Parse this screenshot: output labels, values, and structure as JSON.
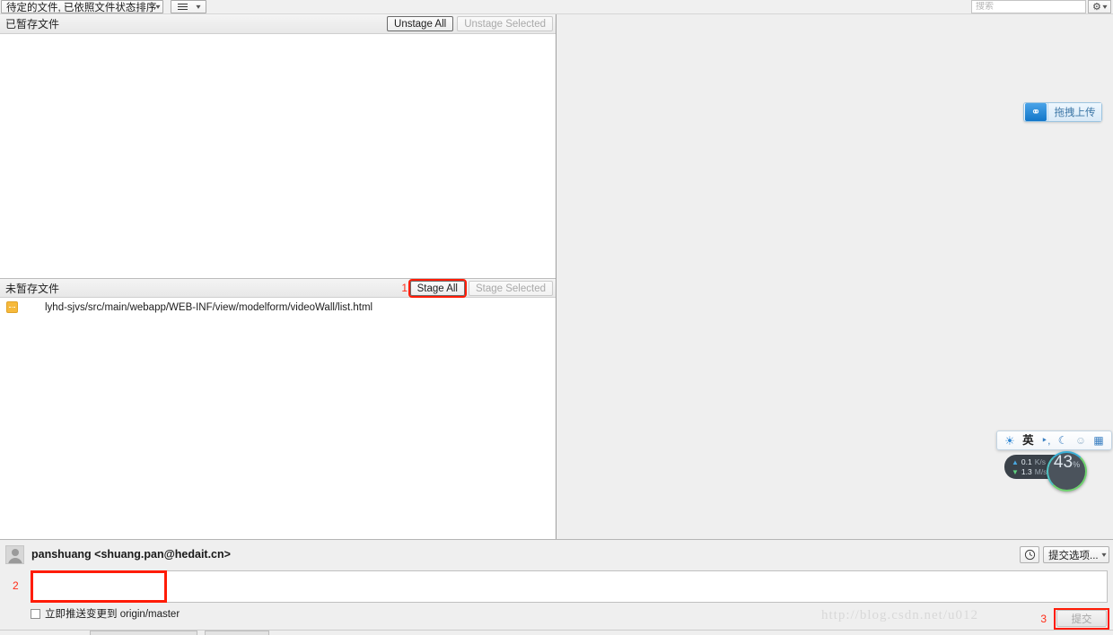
{
  "toolbar": {
    "sort_select_label": "待定的文件, 已依照文件状态排序",
    "view_select_icon": "list-view-icon",
    "caret": "⌄",
    "search_placeholder": "搜索",
    "search_value": "",
    "search_icon": "search-icon",
    "gear_icon": "⚙"
  },
  "staged": {
    "title": "已暂存文件",
    "unstage_all_label": "Unstage All",
    "unstage_selected_label": "Unstage Selected",
    "files": []
  },
  "unstaged": {
    "title": "未暂存文件",
    "stage_all_label": "Stage All",
    "stage_selected_label": "Stage Selected",
    "annotation": "1",
    "files": [
      {
        "path": "lyhd-sjvs/src/main/webapp/WEB-INF/view/modelform/videoWall/list.html",
        "status": "modified"
      }
    ]
  },
  "overlays": {
    "upload_widget": {
      "label": "拖拽上传",
      "icon": "link-upload-icon"
    },
    "ime_bar": {
      "logo_icon": "baidu-paw-icon",
      "mode_label": "英",
      "punctuation_icon": "punctuation-icon",
      "moon_icon": "moon-icon",
      "person_icon": "person-icon",
      "grid_icon": "grid-icon"
    },
    "network_widget": {
      "upload_value": "0.1",
      "upload_unit": "K/s",
      "download_value": "1.3",
      "download_unit": "M/s",
      "percent_value": "43",
      "percent_unit": "%"
    }
  },
  "commit": {
    "author": "panshuang <shuang.pan@hedait.cn>",
    "avatar_icon": "avatar-icon",
    "history_icon": "clock-history-icon",
    "options_label": "提交选项...",
    "message_value": "",
    "message_placeholder": "",
    "message_annotation": "2",
    "push_checkbox_label": "立即推送变更到 origin/master",
    "push_checked": false,
    "commit_button_label": "提交",
    "commit_annotation": "3"
  },
  "watermark": {
    "text": "http://blog.csdn.net/u012"
  },
  "colors": {
    "annotation_red": "#ff1c07",
    "panel_gray": "#efefef",
    "modified_badge": "#f6b93b",
    "accent_blue": "#1277c9"
  }
}
